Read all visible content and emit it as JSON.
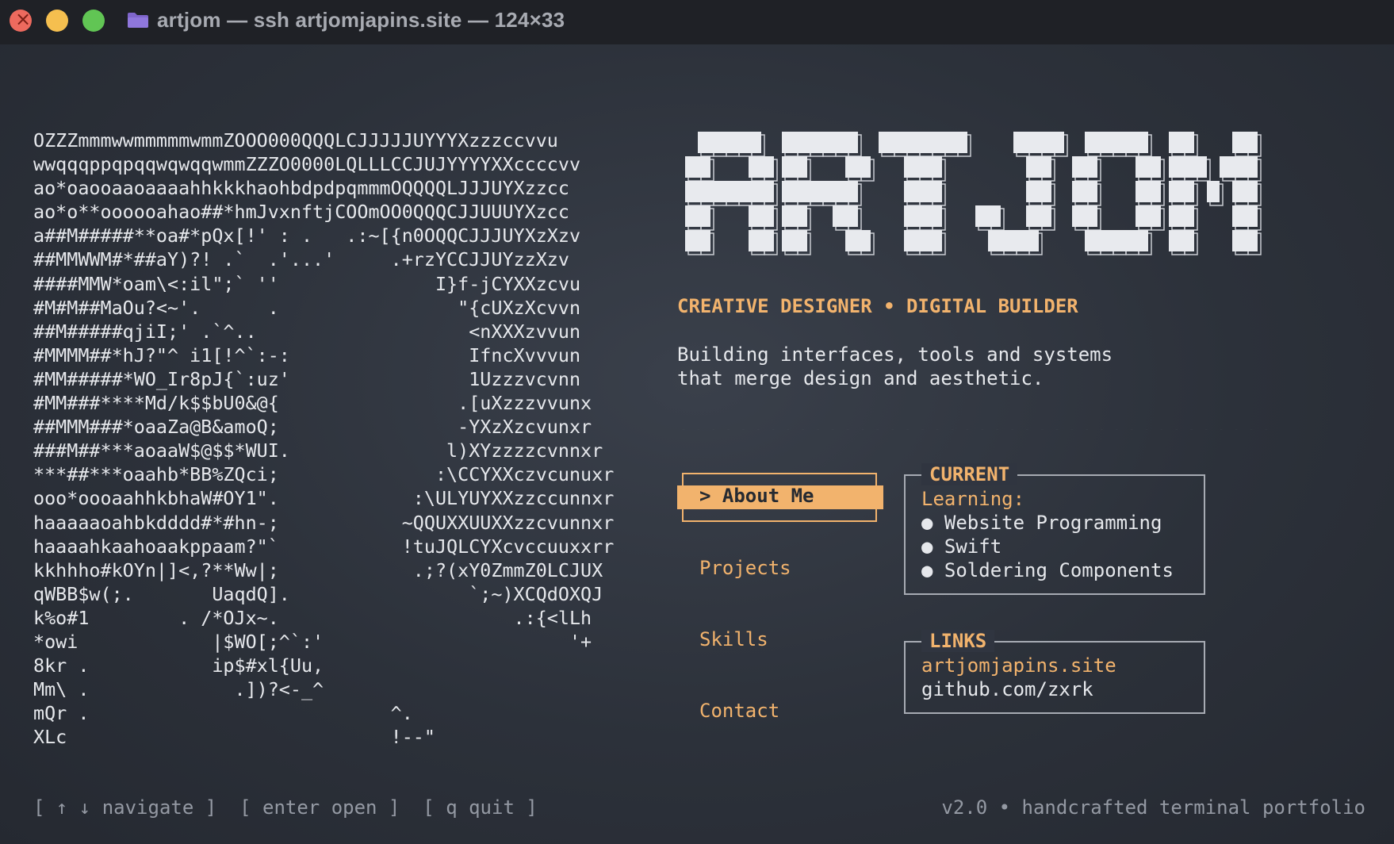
{
  "window": {
    "title": "artjom — ssh artjomjapins.site — 124×33",
    "icons": [
      "close-icon",
      "minimize-icon",
      "maximize-icon",
      "folder-icon"
    ],
    "colors": {
      "accent": "#f2b36d",
      "text": "#e6e8ec",
      "muted": "#9499a3",
      "titlebar": "#1f2126",
      "close": "#ed6a5e",
      "minimize": "#f5bf4f",
      "maximize": "#61c554",
      "folder": "#8a6fd6"
    }
  },
  "portrait": {
    "lines": [
      "OZZZmmmwwmmmmmwmmZOOO000QQQLCJJJJJUYYYXzzzccvvu",
      "wwqqqppqpqqwqwqqwmmZZZO0000LQLLLCCJUJYYYYXXccccvv",
      "ao*oaooaaoaaaahhkkkhaohbdpdpqmmmOQQQQLJJJUYXzzcc",
      "ao*o**oooooahao##*hmJvxnftjCOOmOO0QQQCJJUUUYXzcc",
      "a##M#####**oa#*pQx[!' : .   .:~[{n0OQQCJJJUYXzXzv",
      "##MMWWM#*##aY)?! .`  .'...'     .+rzYCCJJUYzzXzv",
      "####MMW*oam\\<:il\";` ''              I}f-jCYXXzcvu",
      "#M#M##MaOu?<~'.      .                \"{cUXzXcvvn",
      "##M#####qjiI;' .`^..                   <nXXXzvvun",
      "#MMMM##*hJ?\"^ i1[!^`:-:                IfncXvvvun",
      "#MM#####*WO_Ir8pJ{`:uz'                1Uzzzvcvnn",
      "#MM###****Md/k$$bU0&@{                .[uXzzzvvunx",
      "##MMM###*oaaZa@B&amoQ;                -YXzXzcvunxr",
      "###M##***aoaaW$@$$*WUI.              l)XYzzzzcvnnxr",
      "***##***oaahb*BB%ZQci;              :\\CCYXXczvcunuxr",
      "ooo*oooaahhkbhaW#OY1\".            :\\ULYUYXXzzccunnxr",
      "haaaaaoahbkdddd#*#hn-;           ~QQUXXUUXXzzcvunnxr",
      "haaaahkaahoaakppaam?\"`           !tuJQLCYXcvccuuxxrr",
      "kkhhho#kOYn|]<,?**Ww|;            .;?(xY0ZmmZ0LCJUX",
      "qWBB$w(;.       UaqdQ].                `;~)XCQdOXQJ",
      "k%o#1        . /*OJx~.                     .:{<lLh",
      "*owi            |$WO[;^`:'                      '+",
      "8kr .           ip$#xl{Uu,",
      "Mm\\ .             .])?<-_^",
      "mQr .                           ^.",
      "XLc                             !--\""
    ]
  },
  "hero": {
    "logo_text": "ARTJOM",
    "tagline": "CREATIVE DESIGNER • DIGITAL BUILDER",
    "bio_line1": "Building interfaces, tools and systems",
    "bio_line2": "that merge design and aesthetic.",
    "divider": "................................................................"
  },
  "menu": {
    "selected_prefix": "> ",
    "items": [
      {
        "label": "About Me",
        "selected": true
      },
      {
        "label": "Projects",
        "selected": false
      },
      {
        "label": "Skills",
        "selected": false
      },
      {
        "label": "Contact",
        "selected": false
      }
    ]
  },
  "current": {
    "title": "CURRENT",
    "heading": "Learning:",
    "bullet": "●",
    "items": [
      "Website Programming",
      "Swift",
      "Soldering Components"
    ]
  },
  "links": {
    "title": "LINKS",
    "site": "artjomjapins.site",
    "github": "github.com/zxrk"
  },
  "footer": {
    "hints": [
      "[ ↑ ↓ navigate ]",
      "[ enter open ]",
      "[ q quit ]"
    ],
    "version": "v2.0 • handcrafted terminal portfolio"
  }
}
